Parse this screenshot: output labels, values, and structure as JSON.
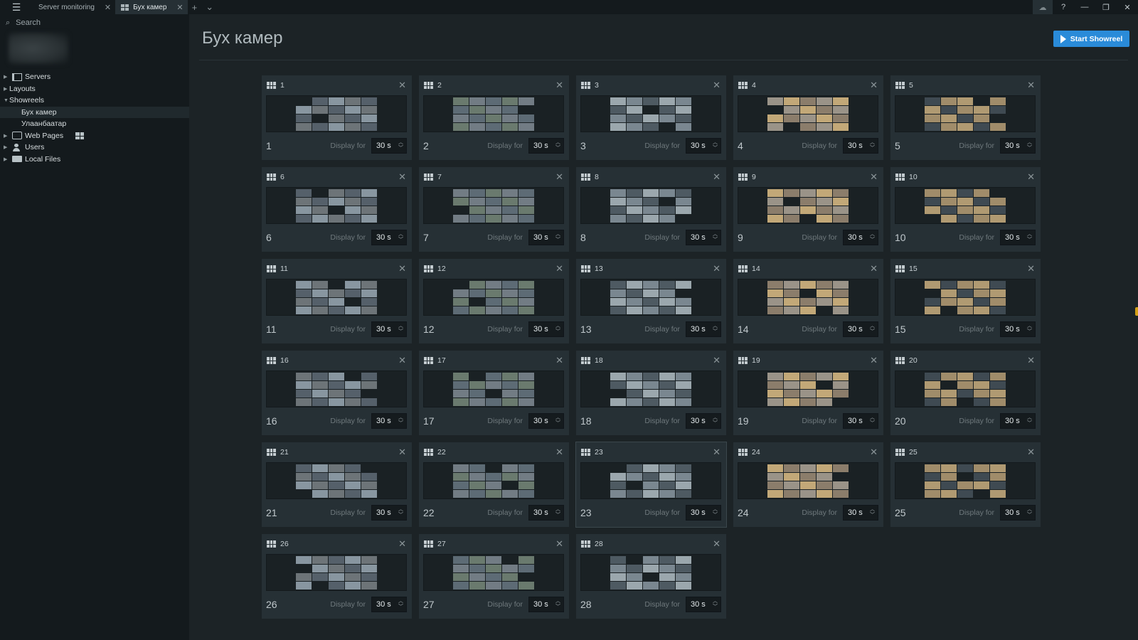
{
  "titlebar": {
    "tabs": [
      {
        "label": "Server monitoring",
        "active": false
      },
      {
        "label": "Бух камер",
        "active": true
      }
    ]
  },
  "sidebar": {
    "search_placeholder": "Search",
    "tree": [
      {
        "label": "Servers",
        "icon": "server-icon",
        "expanded": false,
        "level": 0
      },
      {
        "label": "Layouts",
        "icon": "layout-icon",
        "expanded": false,
        "level": 0
      },
      {
        "label": "Showreels",
        "icon": "showreel-icon",
        "expanded": true,
        "level": 0
      },
      {
        "label": "Бух камер",
        "icon": "showreel-item-icon",
        "level": 1,
        "selected": true
      },
      {
        "label": "Улаанбаатар",
        "icon": "showreel-item-icon",
        "level": 1
      },
      {
        "label": "Web Pages",
        "icon": "web-page-icon",
        "expanded": false,
        "level": 0
      },
      {
        "label": "Users",
        "icon": "users-icon",
        "expanded": false,
        "level": 0
      },
      {
        "label": "Local Files",
        "icon": "folder-icon",
        "expanded": false,
        "level": 0
      }
    ]
  },
  "main": {
    "title": "Бух камер",
    "start_button": "Start Showreel",
    "display_label": "Display for",
    "default_duration": "30 s",
    "cards": [
      {
        "id": "1",
        "name": "1",
        "duration": "30 s"
      },
      {
        "id": "2",
        "name": "2",
        "duration": "30 s"
      },
      {
        "id": "3",
        "name": "3",
        "duration": "30 s"
      },
      {
        "id": "4",
        "name": "4",
        "duration": "30 s"
      },
      {
        "id": "5",
        "name": "5",
        "duration": "30 s"
      },
      {
        "id": "6",
        "name": "6",
        "duration": "30 s"
      },
      {
        "id": "7",
        "name": "7",
        "duration": "30 s"
      },
      {
        "id": "8",
        "name": "8",
        "duration": "30 s"
      },
      {
        "id": "9",
        "name": "9",
        "duration": "30 s"
      },
      {
        "id": "10",
        "name": "10",
        "duration": "30 s"
      },
      {
        "id": "11",
        "name": "11",
        "duration": "30 s"
      },
      {
        "id": "12",
        "name": "12",
        "duration": "30 s"
      },
      {
        "id": "13",
        "name": "13",
        "duration": "30 s"
      },
      {
        "id": "14",
        "name": "14",
        "duration": "30 s"
      },
      {
        "id": "15",
        "name": "15",
        "duration": "30 s"
      },
      {
        "id": "16",
        "name": "16",
        "duration": "30 s"
      },
      {
        "id": "17",
        "name": "17",
        "duration": "30 s"
      },
      {
        "id": "18",
        "name": "18",
        "duration": "30 s"
      },
      {
        "id": "19",
        "name": "19",
        "duration": "30 s"
      },
      {
        "id": "20",
        "name": "20",
        "duration": "30 s"
      },
      {
        "id": "21",
        "name": "21",
        "duration": "30 s"
      },
      {
        "id": "22",
        "name": "22",
        "duration": "30 s"
      },
      {
        "id": "23",
        "name": "23",
        "duration": "30 s",
        "highlighted": true
      },
      {
        "id": "24",
        "name": "24",
        "duration": "30 s"
      },
      {
        "id": "25",
        "name": "25",
        "duration": "30 s"
      },
      {
        "id": "26",
        "name": "26",
        "duration": "30 s"
      },
      {
        "id": "27",
        "name": "27",
        "duration": "30 s"
      },
      {
        "id": "28",
        "name": "28",
        "duration": "30 s"
      }
    ]
  },
  "colors": {
    "accent": "#2a8bd9",
    "panel": "#263035",
    "background": "#1c2326",
    "sidebar": "#141a1d"
  }
}
